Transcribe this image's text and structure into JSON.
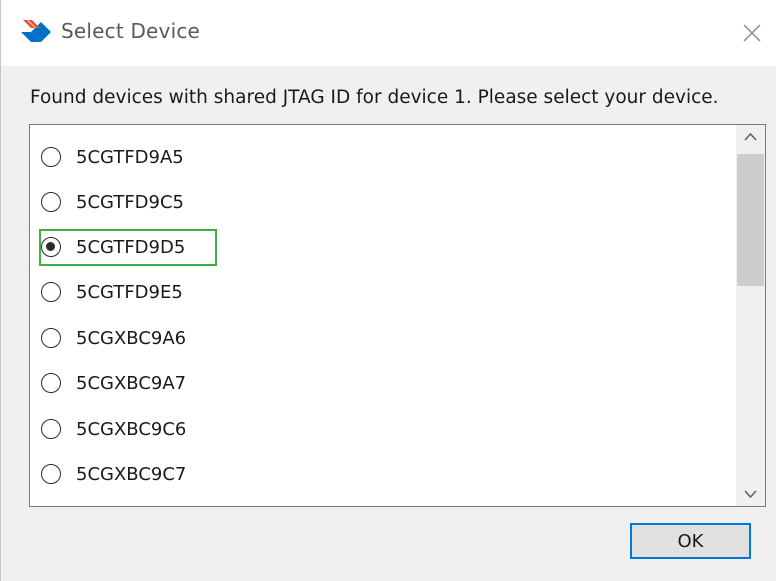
{
  "window": {
    "title": "Select Device",
    "close_icon": "close-icon",
    "app_icon": "intel-logo-icon"
  },
  "instruction": "Found devices with shared JTAG ID for device 1. Please select your device.",
  "devices": [
    {
      "label": "5CGTFD9A5",
      "checked": false
    },
    {
      "label": "5CGTFD9C5",
      "checked": false
    },
    {
      "label": "5CGTFD9D5",
      "checked": true
    },
    {
      "label": "5CGTFD9E5",
      "checked": false
    },
    {
      "label": "5CGXBC9A6",
      "checked": false
    },
    {
      "label": "5CGXBC9A7",
      "checked": false
    },
    {
      "label": "5CGXBC9C6",
      "checked": false
    },
    {
      "label": "5CGXBC9C7",
      "checked": false
    }
  ],
  "selected_device": "5CGTFD9D5",
  "buttons": {
    "ok_label": "OK"
  },
  "colors": {
    "accent": "#0078d7",
    "highlight": "#3cb043"
  }
}
